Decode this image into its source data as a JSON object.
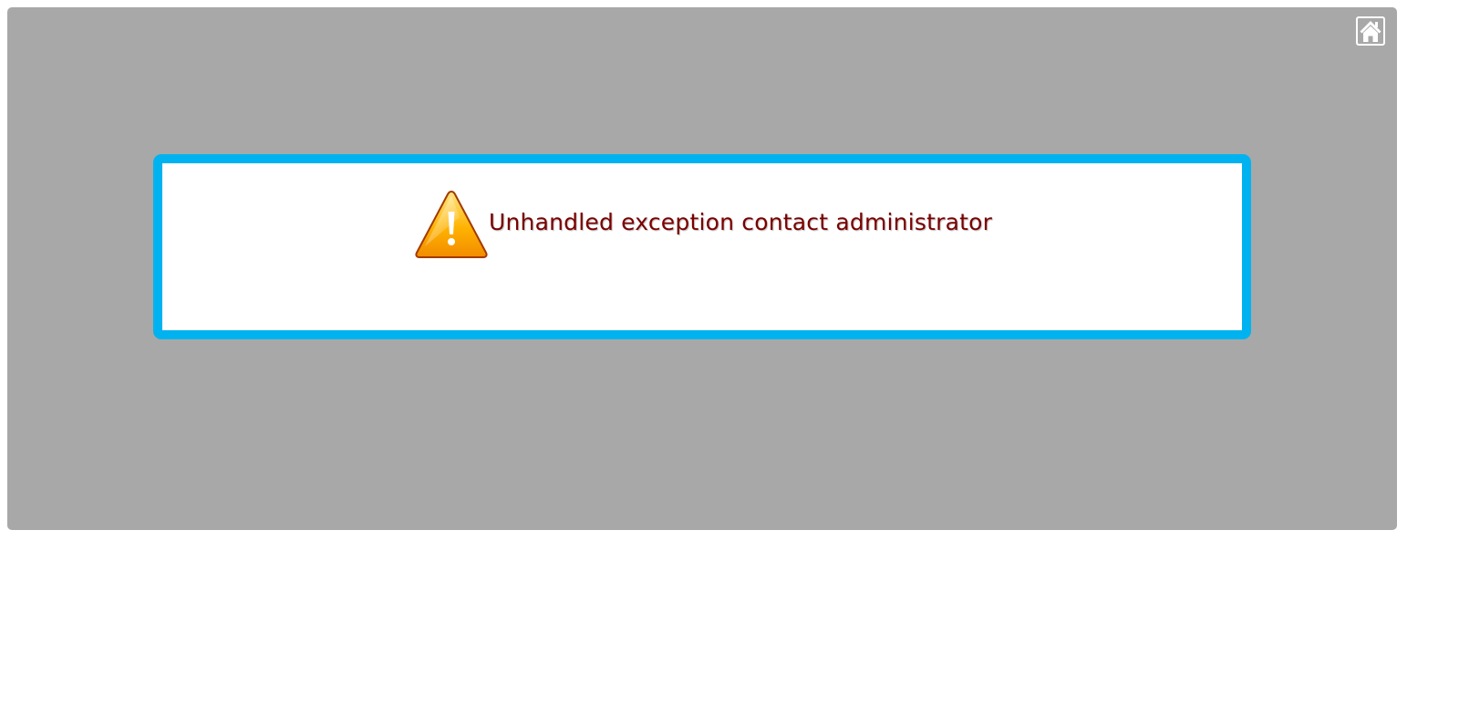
{
  "colors": {
    "page_background": "#ffffff",
    "overlay_background": "#a8a8a8",
    "dialog_border": "#00b3f0",
    "message_text": "#7a0000",
    "warning_fill_top": "#ffe680",
    "warning_fill_bottom": "#f28c00",
    "warning_outline": "#a33a00"
  },
  "header": {
    "home_icon": "home-icon"
  },
  "dialog": {
    "icon": "warning-icon",
    "message": "Unhandled exception contact administrator"
  }
}
